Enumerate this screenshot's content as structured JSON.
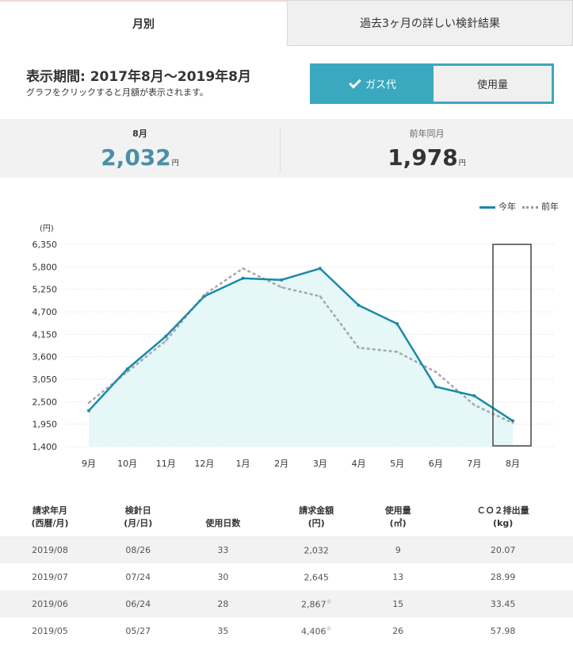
{
  "tabs": [
    {
      "label": "月別",
      "active": true
    },
    {
      "label": "過去3ヶ月の詳しい検針結果",
      "active": false
    }
  ],
  "period": {
    "title": "表示期間: 2017年8月～2019年8月",
    "subtitle": "グラフをクリックすると月額が表示されます。"
  },
  "toggle": {
    "gas_label": "ガス代",
    "usage_label": "使用量",
    "selected": "ガス代"
  },
  "summary": {
    "current_label": "8月",
    "current_value": "2,032",
    "current_unit": "円",
    "prev_label": "前年同月",
    "prev_value": "1,978",
    "prev_unit": "円"
  },
  "legend": {
    "this_year": "今年",
    "last_year": "前年"
  },
  "colors": {
    "accent": "#3aa9bf",
    "this_year_line": "#1a8aa8",
    "area_fill": "#e6f7f8",
    "last_year_line": "#999999"
  },
  "chart_data": {
    "type": "line",
    "unit_label": "(円)",
    "categories": [
      "9月",
      "10月",
      "11月",
      "12月",
      "1月",
      "2月",
      "3月",
      "4月",
      "5月",
      "6月",
      "7月",
      "8月"
    ],
    "yticks": [
      1400,
      1950,
      2500,
      3050,
      3600,
      4150,
      4700,
      5250,
      5800,
      6350
    ],
    "ytick_labels": [
      "1,400",
      "1,950",
      "2,500",
      "3,050",
      "3,600",
      "4,150",
      "4,700",
      "5,250",
      "5,800",
      "6,350"
    ],
    "ylim": [
      1400,
      6350
    ],
    "series": [
      {
        "name": "今年",
        "style": "solid",
        "values": [
          2280,
          3300,
          4100,
          5080,
          5520,
          5480,
          5760,
          4860,
          4406,
          2867,
          2645,
          2032
        ]
      },
      {
        "name": "前年",
        "style": "dotted",
        "values": [
          2470,
          3230,
          3990,
          5120,
          5760,
          5300,
          5080,
          3820,
          3720,
          3230,
          2420,
          1978
        ]
      }
    ],
    "highlight_category": "8月",
    "grid": true
  },
  "table": {
    "headers": [
      {
        "line1": "請求年月",
        "line2": "(西暦/月)"
      },
      {
        "line1": "検針日",
        "line2": "(月/日)"
      },
      {
        "line1": "使用日数",
        "line2": ""
      },
      {
        "line1": "請求金額",
        "line2": "(円)"
      },
      {
        "line1": "使用量",
        "line2": "(㎥)"
      },
      {
        "line1": "ＣＯ２排出量",
        "line2": "(kg)"
      }
    ],
    "rows": [
      {
        "month": "2019/08",
        "date": "08/26",
        "days": "33",
        "amount": "2,032",
        "mark": "",
        "usage": "9",
        "co2": "20.07"
      },
      {
        "month": "2019/07",
        "date": "07/24",
        "days": "30",
        "amount": "2,645",
        "mark": "",
        "usage": "13",
        "co2": "28.99"
      },
      {
        "month": "2019/06",
        "date": "06/24",
        "days": "28",
        "amount": "2,867",
        "mark": "※",
        "usage": "15",
        "co2": "33.45"
      },
      {
        "month": "2019/05",
        "date": "05/27",
        "days": "35",
        "amount": "4,406",
        "mark": "※",
        "usage": "26",
        "co2": "57.98"
      }
    ]
  }
}
